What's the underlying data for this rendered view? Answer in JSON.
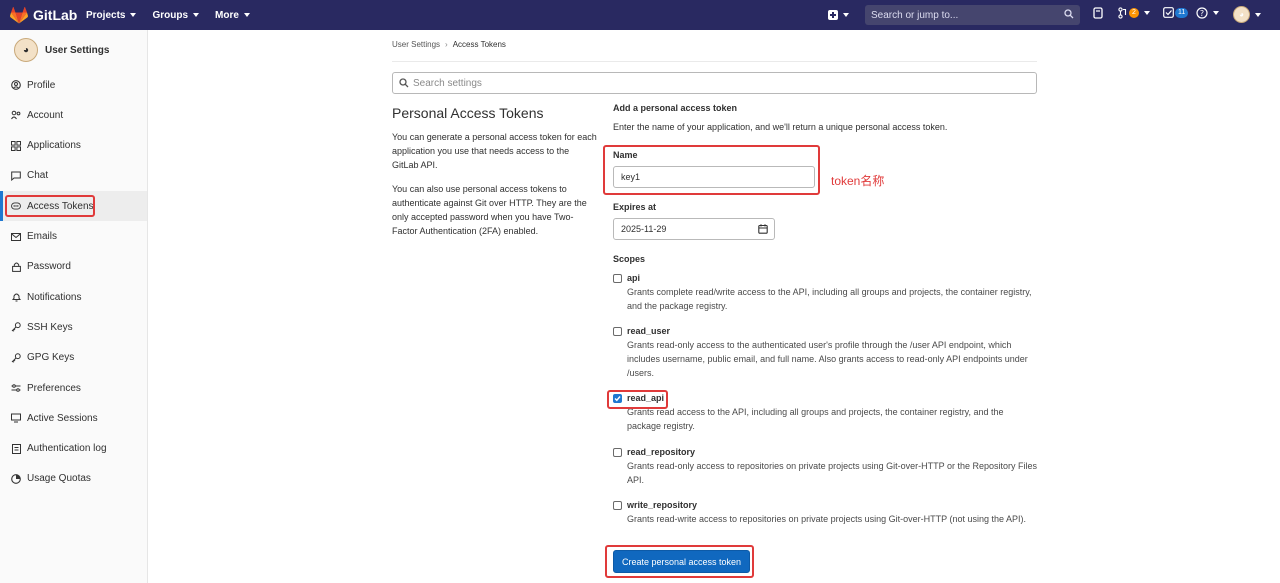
{
  "navbar": {
    "brand": "GitLab",
    "menu": [
      "Projects",
      "Groups",
      "More"
    ],
    "search_placeholder": "Search or jump to...",
    "merge_requests_count": "2",
    "todos_count": "11"
  },
  "sidebar": {
    "title": "User Settings",
    "items": [
      {
        "label": "Profile",
        "icon": "profile-icon"
      },
      {
        "label": "Account",
        "icon": "account-icon"
      },
      {
        "label": "Applications",
        "icon": "applications-icon"
      },
      {
        "label": "Chat",
        "icon": "chat-icon"
      },
      {
        "label": "Access Tokens",
        "icon": "token-icon",
        "active": true
      },
      {
        "label": "Emails",
        "icon": "mail-icon"
      },
      {
        "label": "Password",
        "icon": "lock-icon"
      },
      {
        "label": "Notifications",
        "icon": "bell-icon"
      },
      {
        "label": "SSH Keys",
        "icon": "key-icon"
      },
      {
        "label": "GPG Keys",
        "icon": "key-icon"
      },
      {
        "label": "Preferences",
        "icon": "preferences-icon"
      },
      {
        "label": "Active Sessions",
        "icon": "monitor-icon"
      },
      {
        "label": "Authentication log",
        "icon": "log-icon"
      },
      {
        "label": "Usage Quotas",
        "icon": "quota-icon"
      }
    ]
  },
  "breadcrumb": {
    "parent": "User Settings",
    "current": "Access Tokens"
  },
  "search_settings": {
    "placeholder": "Search settings"
  },
  "intro": {
    "title": "Personal Access Tokens",
    "p1": "You can generate a personal access token for each application you use that needs access to the GitLab API.",
    "p2": "You can also use personal access tokens to authenticate against Git over HTTP. They are the only accepted password when you have Two-Factor Authentication (2FA) enabled."
  },
  "form": {
    "heading": "Add a personal access token",
    "description": "Enter the name of your application, and we'll return a unique personal access token.",
    "name_label": "Name",
    "name_value": "key1",
    "name_annotation": "token名称",
    "expires_label": "Expires at",
    "expires_value": "2025-11-29",
    "scopes_label": "Scopes",
    "scopes": [
      {
        "name": "api",
        "checked": false,
        "description": "Grants complete read/write access to the API, including all groups and projects, the container registry, and the package registry."
      },
      {
        "name": "read_user",
        "checked": false,
        "description": "Grants read-only access to the authenticated user's profile through the /user API endpoint, which includes username, public email, and full name. Also grants access to read-only API endpoints under /users."
      },
      {
        "name": "read_api",
        "checked": true,
        "description": "Grants read access to the API, including all groups and projects, the container registry, and the package registry."
      },
      {
        "name": "read_repository",
        "checked": false,
        "description": "Grants read-only access to repositories on private projects using Git-over-HTTP or the Repository Files API."
      },
      {
        "name": "write_repository",
        "checked": false,
        "description": "Grants read-write access to repositories on private projects using Git-over-HTTP (not using the API)."
      }
    ],
    "submit_label": "Create personal access token"
  }
}
